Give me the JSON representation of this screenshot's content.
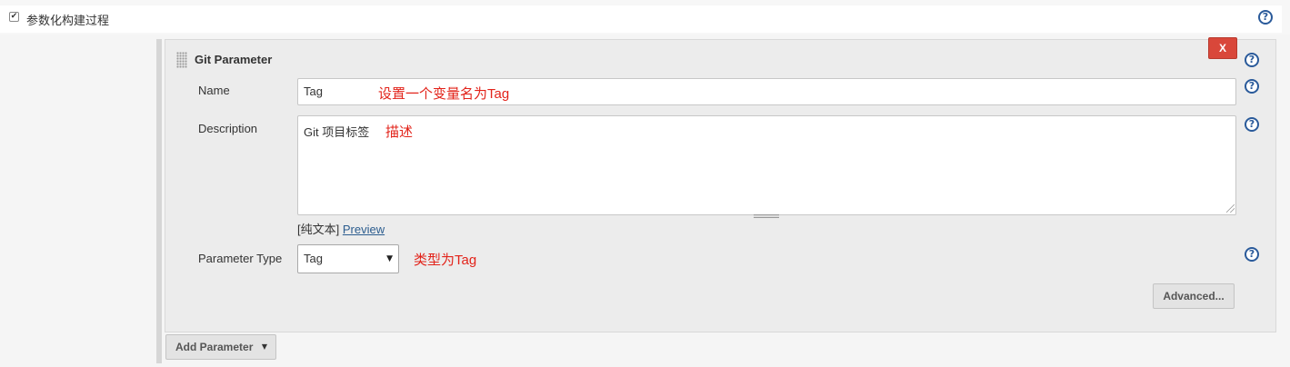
{
  "section": {
    "checkbox_glyph": "✔",
    "label": "参数化构建过程"
  },
  "parameter": {
    "title": "Git Parameter",
    "delete_label": "X",
    "name": {
      "label": "Name",
      "value": "Tag",
      "annotation": "设置一个变量名为Tag"
    },
    "description": {
      "label": "Description",
      "value": "Git 项目标签",
      "annotation": "描述"
    },
    "markup": {
      "prefix": "[纯文本]",
      "preview_link": "Preview"
    },
    "parameter_type": {
      "label": "Parameter Type",
      "selected": "Tag",
      "annotation": "类型为Tag"
    },
    "advanced_label": "Advanced..."
  },
  "add_parameter_label": "Add Parameter",
  "icons": {
    "help": "?",
    "caret": "▼"
  },
  "colors": {
    "delete": "#d9473a",
    "annotation": "#e2231a",
    "link": "#2c5d8f",
    "help": "#2a5a9a"
  }
}
